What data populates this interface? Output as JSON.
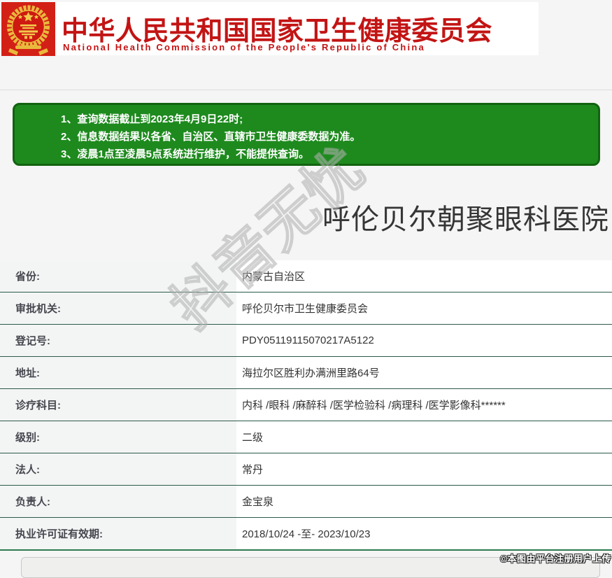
{
  "header": {
    "emblem_icon": "china-national-emblem-icon",
    "title_cn": "中华人民共和国国家卫生健康委员会",
    "title_en": "National Health Commission of the People's Republic of China"
  },
  "notice": {
    "lines": [
      "1、查询数据截止到2023年4月9日22时;",
      "2、信息数据结果以各省、自治区、直辖市卫生健康委数据为准。",
      "3、凌晨1点至凌晨5点系统进行维护，不能提供查询。"
    ]
  },
  "hospital": {
    "name": "呼伦贝尔朝聚眼科医院",
    "fields": [
      {
        "label": "省份:",
        "value": "内蒙古自治区"
      },
      {
        "label": "审批机关:",
        "value": "呼伦贝尔市卫生健康委员会"
      },
      {
        "label": "登记号:",
        "value": "PDY05119115070217A5122"
      },
      {
        "label": "地址:",
        "value": "海拉尔区胜利办满洲里路64号"
      },
      {
        "label": "诊疗科目:",
        "value": "内科 /眼科 /麻醉科 /医学检验科 /病理科 /医学影像科******"
      },
      {
        "label": "级别:",
        "value": "二级"
      },
      {
        "label": "法人:",
        "value": "常丹"
      },
      {
        "label": "负责人:",
        "value": "金宝泉"
      },
      {
        "label": "执业许可证有效期:",
        "value": "2018/10/24 -至- 2023/10/23"
      }
    ]
  },
  "watermark": "抖音无忧",
  "footer": {
    "copyright": "©本图由平台注册用户上传"
  },
  "colors": {
    "brand_red": "#c31414",
    "notice_green": "#1e8a1e",
    "notice_border_green": "#126310",
    "row_separator_green": "#2b5a48",
    "page_background": "#f5f5f5"
  }
}
